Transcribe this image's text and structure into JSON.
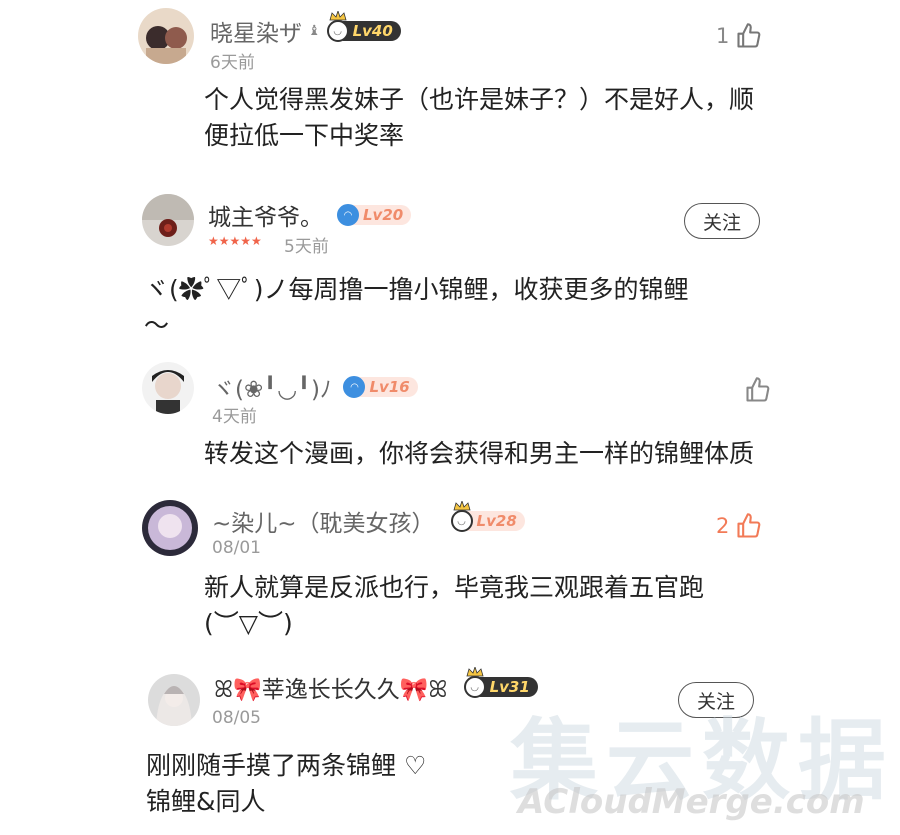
{
  "comments": [
    {
      "username": "晓星染ザ",
      "level": "Lv40",
      "time": "6天前",
      "likes": "1",
      "text": "个人觉得黑发妹子（也许是妹子？）不是好人，顺\n便拉低一下中奖率"
    },
    {
      "username": "城主爷爷。",
      "level": "Lv20",
      "stars": "★★★★★",
      "rating": 5,
      "time": "5天前",
      "follow_label": "关注",
      "text": "ヾ(✿ﾟ▽ﾟ)ノ每周撸一撸小锦鲤，收获更多的锦鲤\n～"
    },
    {
      "username": "ヾ(❀╹◡╹)ﾉ",
      "level": "Lv16",
      "time": "4天前",
      "likes": "",
      "text": "转发这个漫画，你将会获得和男主一样的锦鲤体质"
    },
    {
      "username": "~染儿~（耽美女孩）",
      "level": "Lv28",
      "time": "08/01",
      "likes": "2",
      "text": "新人就算是反派也行，毕竟我三观跟着五官跑\n(︶▽︶)"
    },
    {
      "username": "ꕤ🎀莘逸长长久久🎀ꕤ",
      "level": "Lv31",
      "time": "08/05",
      "follow_label": "关注",
      "text": "刚刚随手摸了两条锦鲤 ♡\n锦鲤&同人"
    }
  ],
  "watermark": {
    "cn": "集云数据",
    "en": "ACloudMerge.com"
  }
}
